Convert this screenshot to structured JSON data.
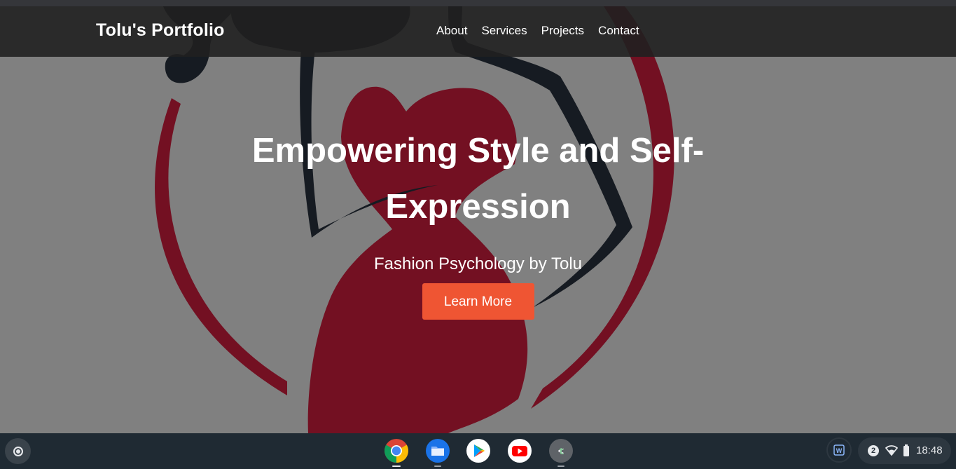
{
  "site": {
    "brand": "Tolu's Portfolio",
    "nav": [
      "About",
      "Services",
      "Projects",
      "Contact"
    ]
  },
  "hero": {
    "title_line1": "Empowering Style and Self-",
    "title_line2": "Expression",
    "subtitle": "Fashion Psychology by Tolu",
    "cta_label": "Learn More"
  },
  "shelf": {
    "launcher_icon": "launcher-circle-icon",
    "apps": [
      {
        "name": "Chrome",
        "icon": "chrome-icon",
        "active": true
      },
      {
        "name": "Files",
        "icon": "files-icon",
        "active": false
      },
      {
        "name": "Play Store",
        "icon": "play-store-icon",
        "active": false
      },
      {
        "name": "YouTube",
        "icon": "youtube-icon",
        "active": false
      },
      {
        "name": "Terminal",
        "icon": "terminal-icon",
        "active": false
      }
    ],
    "tray": {
      "notification_count": "2",
      "time": "18:48"
    }
  },
  "colors": {
    "hero_bg": "#808080",
    "logo_red": "#731022",
    "logo_dark": "#161b22",
    "cta": "#ef5533",
    "header_bg": "#202020",
    "shelf_bg": "#1f2a33"
  }
}
